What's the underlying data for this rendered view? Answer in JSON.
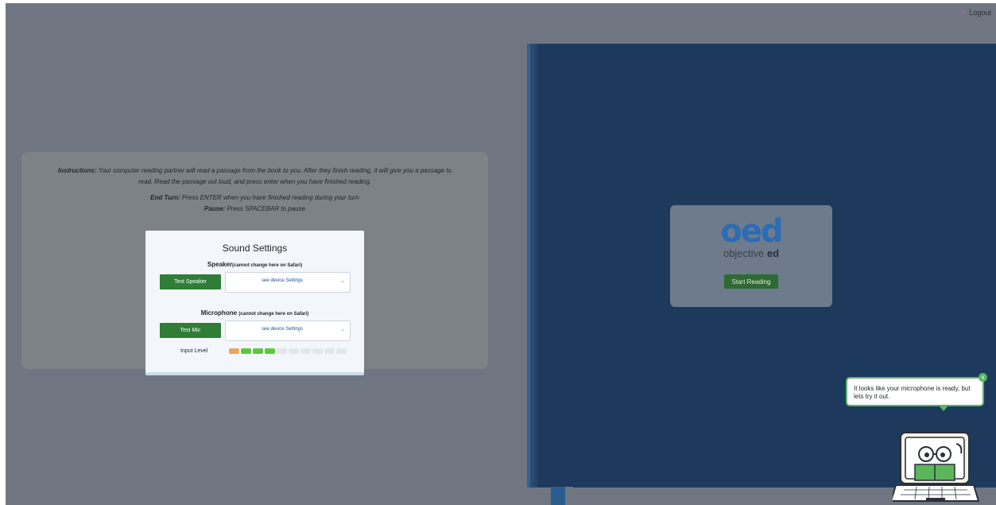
{
  "header": {
    "logout_label": "Logout",
    "logout_icon": "logout-icon"
  },
  "instructions": {
    "instr_bold": "Instructions:",
    "instr_text": " Your computer reading partner will read a passage from the book to you. After they finish reading, it will give you a passage to read. Read the passage out loud, and press enter when you have finished reading.",
    "endturn_bold": "End Turn:",
    "endturn_text": " Press ENTER when you have finished reading during your turn",
    "pause_bold": "Pause:",
    "pause_text": " Press SPACEBAR to pause"
  },
  "book": {
    "logo_text": "oed",
    "sub_prefix": "objective ",
    "sub_bold": "ed",
    "start_label": "Start Reading"
  },
  "sound_settings": {
    "title": "Sound Settings",
    "speaker_label": "Speaker",
    "speaker_note": "(cannot change here on Safari)",
    "test_speaker_label": "Test Speaker",
    "speaker_select_value": "see device Settings",
    "mic_label": "Microphone ",
    "mic_note": "(cannot change here on Safari)",
    "test_mic_label": "Test Mic",
    "mic_select_value": "see device Settings",
    "input_level_label": "Input Level",
    "input_level_segments": 10,
    "input_level_active": 4,
    "colors": {
      "orange": "#e8a560",
      "green": "#5cc83a",
      "off": "#e3e6ea",
      "button": "#2f7d36"
    }
  },
  "helper": {
    "message": "It looks like your microphone is ready, but lets try it out.",
    "close_label": "x"
  }
}
